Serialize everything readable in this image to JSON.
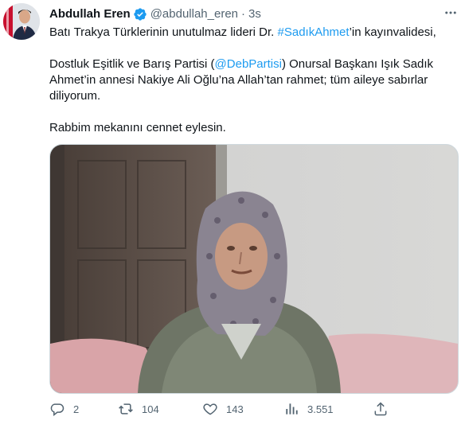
{
  "tweet": {
    "author": {
      "name": "Abdullah Eren",
      "handle": "@abdullah_eren",
      "separator": "·",
      "time": "3s",
      "avatar_icon": "avatar-photo",
      "verified_color": "#1d9bf0"
    },
    "text": {
      "line1_before": "Batı Trakya Türklerinin unutulmaz lideri Dr. ",
      "line1_hashtag": "#SadıkAhmet",
      "line1_after": "’in kayınvalidesi,",
      "p2_l1_before": "Dostluk Eşitlik ve Barış Partisi (",
      "p2_l1_mention": "@DebPartisi",
      "p2_l1_after": ") Onursal Başkanı Işık Sadık",
      "p2_l2": "Ahmet’in annesi Nakiye Ali Oğlu’na Allah’tan rahmet; tüm aileye sabırlar",
      "p2_l3": "diliyorum.",
      "p3": "Rabbim mekanını cennet eylesin."
    },
    "media": {
      "description_icon": "photo"
    },
    "actions": {
      "replies": "2",
      "retweets": "104",
      "likes": "143",
      "views": "3.551"
    },
    "colors": {
      "link": "#1d9bf0",
      "muted": "#536471",
      "text": "#0f1419"
    }
  }
}
